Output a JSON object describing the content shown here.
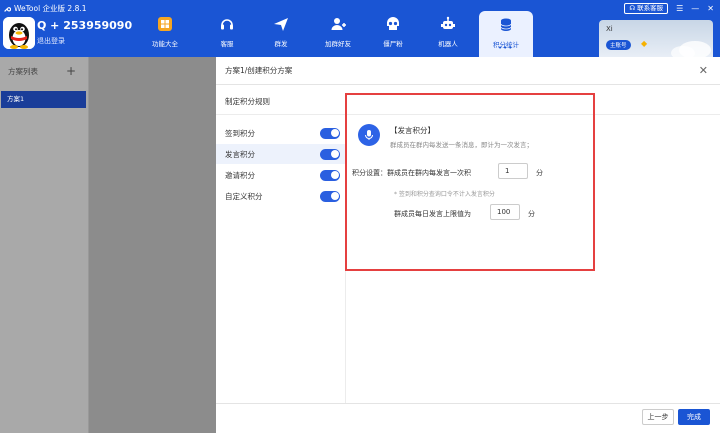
{
  "app": {
    "title": "WeTool 企业版 2.8.1",
    "account_name": "Q + 253959090",
    "logout_label": "退出登录"
  },
  "nav": {
    "items": [
      {
        "label": "功能大全",
        "icon": "grid-icon"
      },
      {
        "label": "客服",
        "icon": "headset-icon"
      },
      {
        "label": "群发",
        "icon": "send-icon"
      },
      {
        "label": "加群好友",
        "icon": "add-user-icon"
      },
      {
        "label": "僵尸粉",
        "icon": "skull-icon"
      },
      {
        "label": "机器人",
        "icon": "robot-icon"
      },
      {
        "label": "积分统计",
        "icon": "database-icon",
        "active": true
      }
    ],
    "dots": "•••"
  },
  "window": {
    "contact_label": "联系客服"
  },
  "cloud_card": {
    "title": "Xi",
    "badge": "主账号"
  },
  "left_panel": {
    "title": "方案列表",
    "add": "+",
    "items": [
      "方案1"
    ]
  },
  "dialog": {
    "breadcrumb": "方案1/创建积分方案",
    "close": "✕",
    "rules_title": "制定积分规则",
    "rules": [
      {
        "label": "签到积分",
        "on": true
      },
      {
        "label": "发言积分",
        "on": true,
        "active": true
      },
      {
        "label": "邀请积分",
        "on": true
      },
      {
        "label": "自定义积分",
        "on": true
      }
    ],
    "content": {
      "title": "【发言积分】",
      "description": "群成员在群内每发送一条消息，即计为一次发言；",
      "setting_label": "积分设置：群成员在群内每发言一次积",
      "points_value": "1",
      "unit": "分",
      "hint": "* 签到和积分查询口令不计入发言积分",
      "limit_label": "群成员每日发言上限值为",
      "limit_value": "100",
      "limit_unit": "分"
    },
    "buttons": {
      "prev": "上一步",
      "done": "完成"
    }
  },
  "colors": {
    "brand": "#1a55d4",
    "highlight_frame": "#e54040"
  }
}
